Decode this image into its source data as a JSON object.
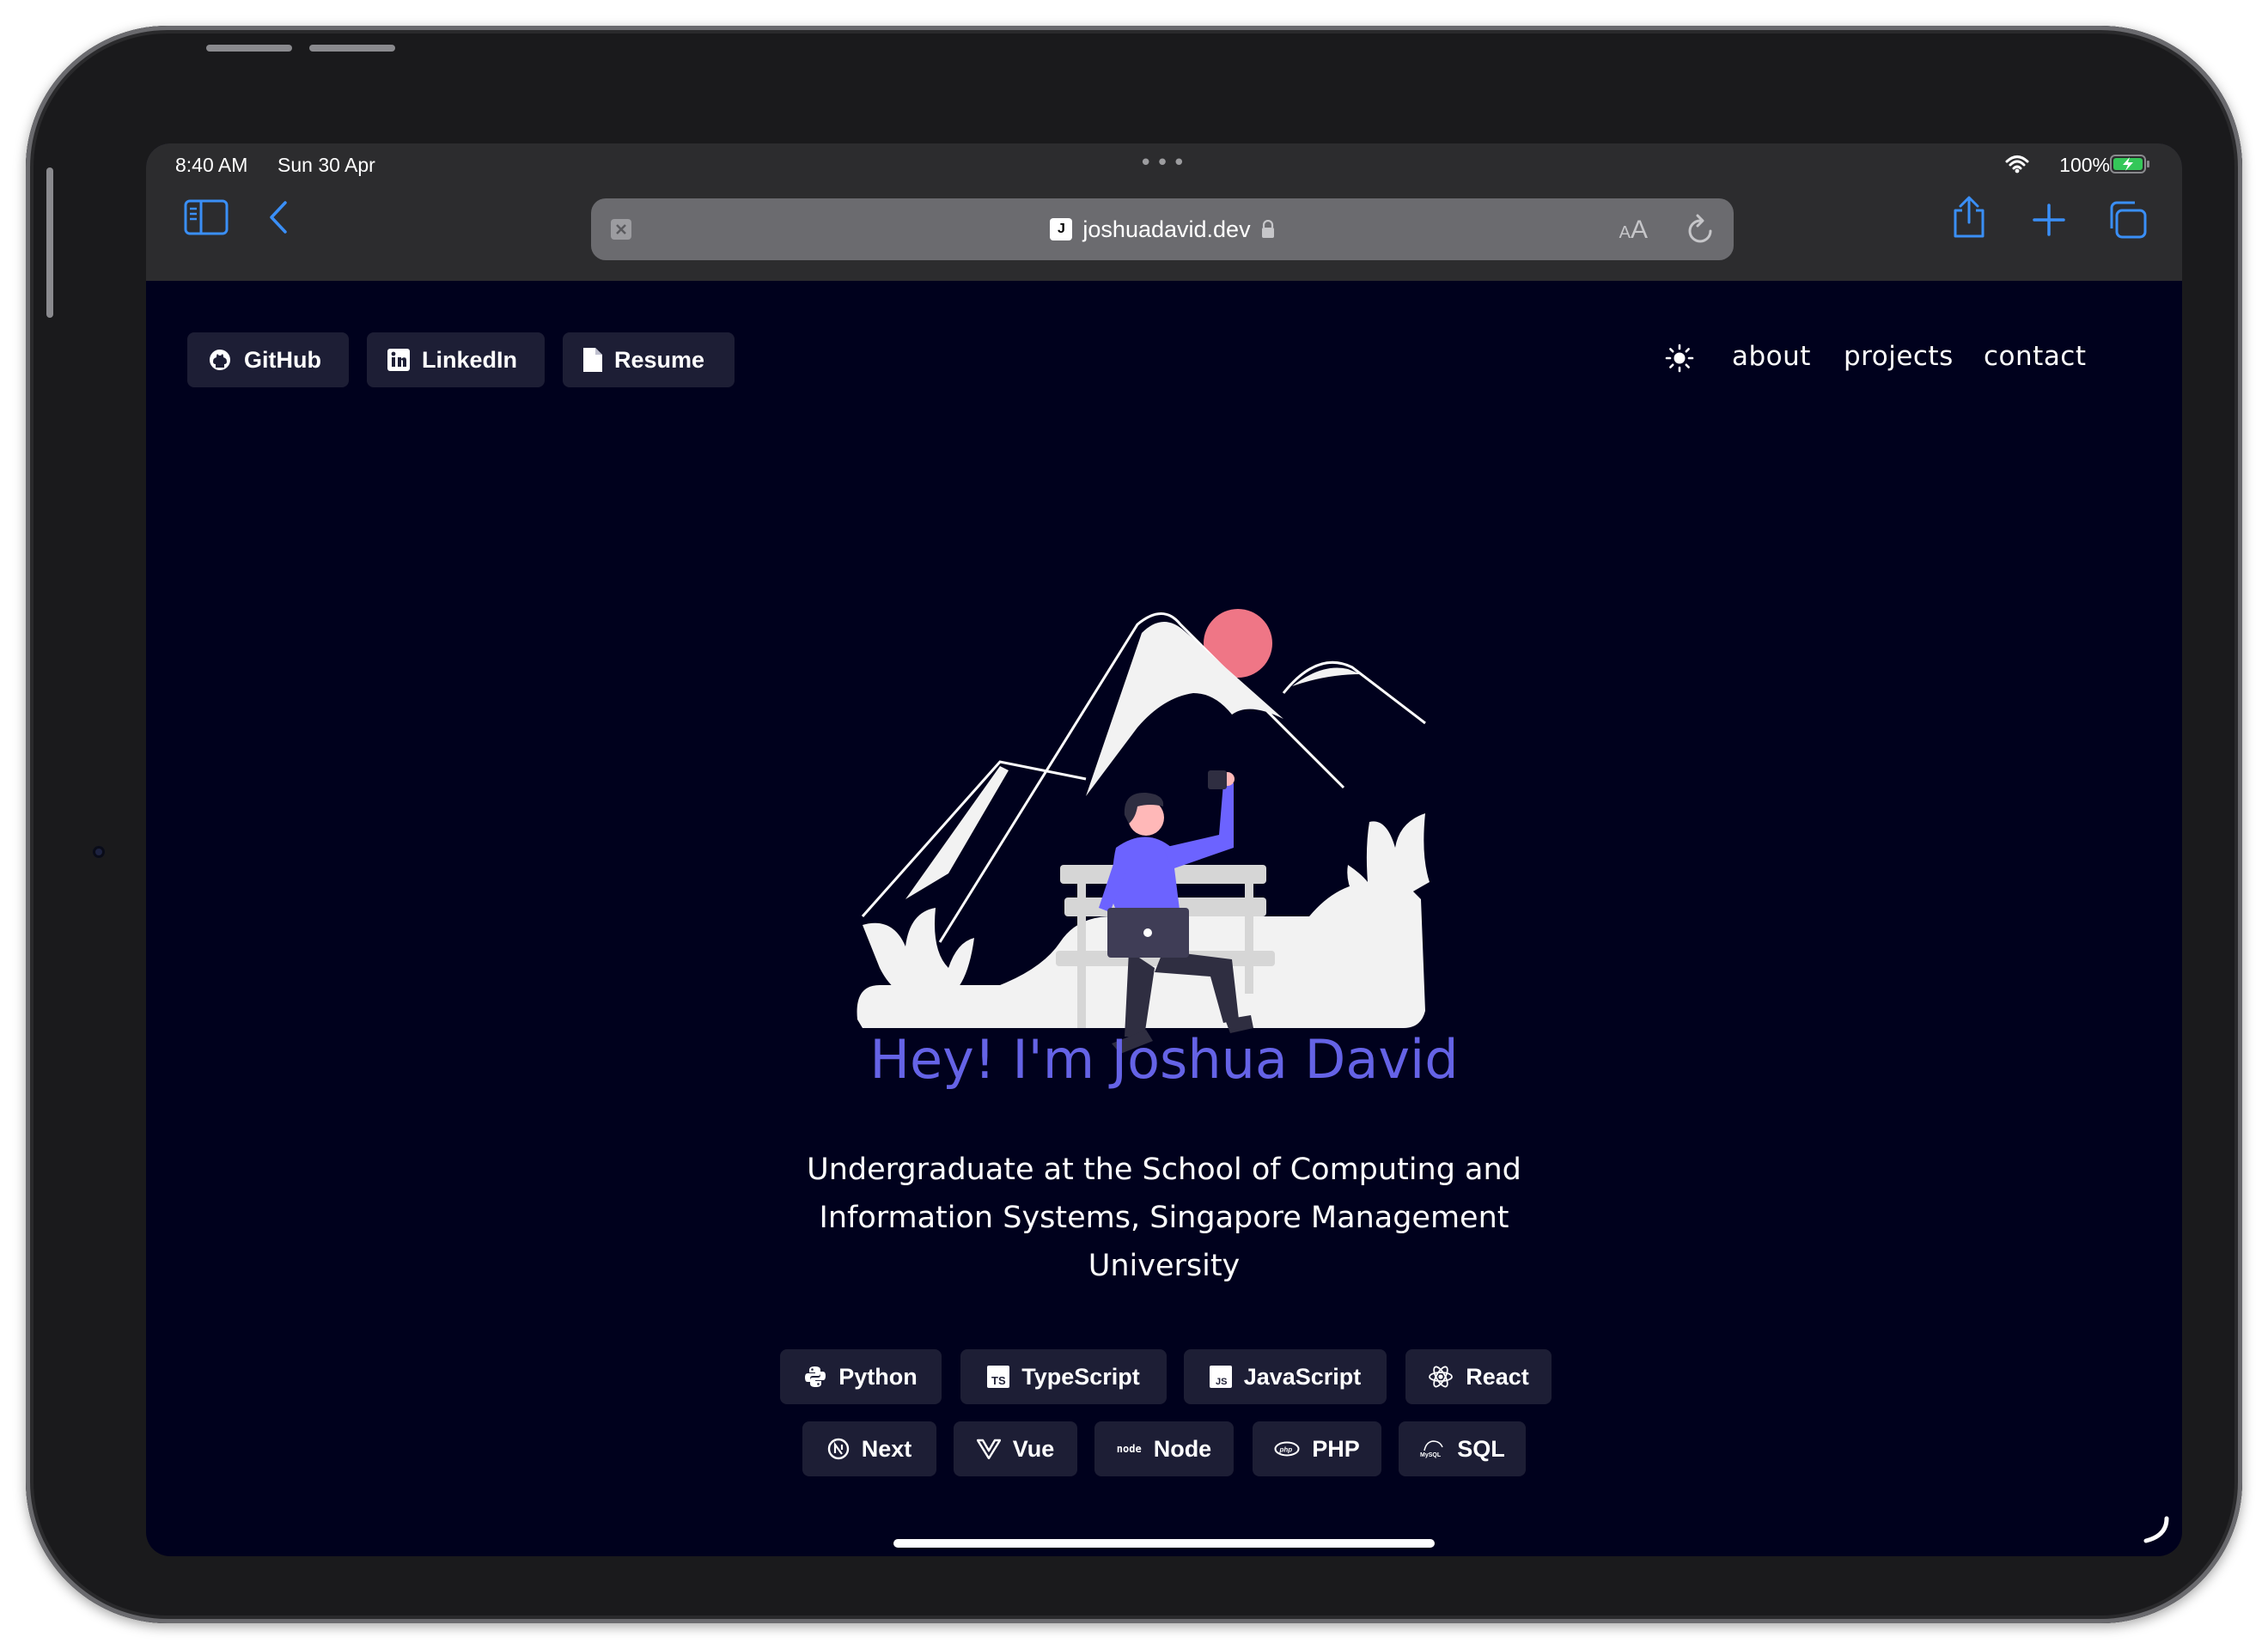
{
  "status": {
    "time": "8:40 AM",
    "date": "Sun 30 Apr",
    "battery": "100%"
  },
  "browser": {
    "url": "joshuadavid.dev",
    "favicon_letter": "J",
    "aa_small": "A",
    "aa_big": "A"
  },
  "header": {
    "buttons": [
      {
        "label": "GitHub",
        "icon": "github-icon"
      },
      {
        "label": "LinkedIn",
        "icon": "linkedin-icon"
      },
      {
        "label": "Resume",
        "icon": "document-icon"
      }
    ],
    "links": [
      "about",
      "projects",
      "contact"
    ]
  },
  "hero": {
    "title": "Hey! I'm Joshua David",
    "subtitle": "Undergraduate at the School of Computing and Information Systems, Singapore Management University"
  },
  "skills": [
    {
      "label": "Python",
      "icon": "python-icon"
    },
    {
      "label": "TypeScript",
      "icon": "typescript-icon"
    },
    {
      "label": "JavaScript",
      "icon": "javascript-icon"
    },
    {
      "label": "React",
      "icon": "react-icon"
    },
    {
      "label": "Next",
      "icon": "nextjs-icon"
    },
    {
      "label": "Vue",
      "icon": "vue-icon"
    },
    {
      "label": "Node",
      "icon": "node-icon"
    },
    {
      "label": "PHP",
      "icon": "php-icon"
    },
    {
      "label": "SQL",
      "icon": "mysql-icon"
    }
  ],
  "colors": {
    "background": "#00011d",
    "accent": "#6563e6",
    "chip": "#1d1e35",
    "sun": "#ef7686",
    "figure_shirt": "#6c63ff"
  }
}
